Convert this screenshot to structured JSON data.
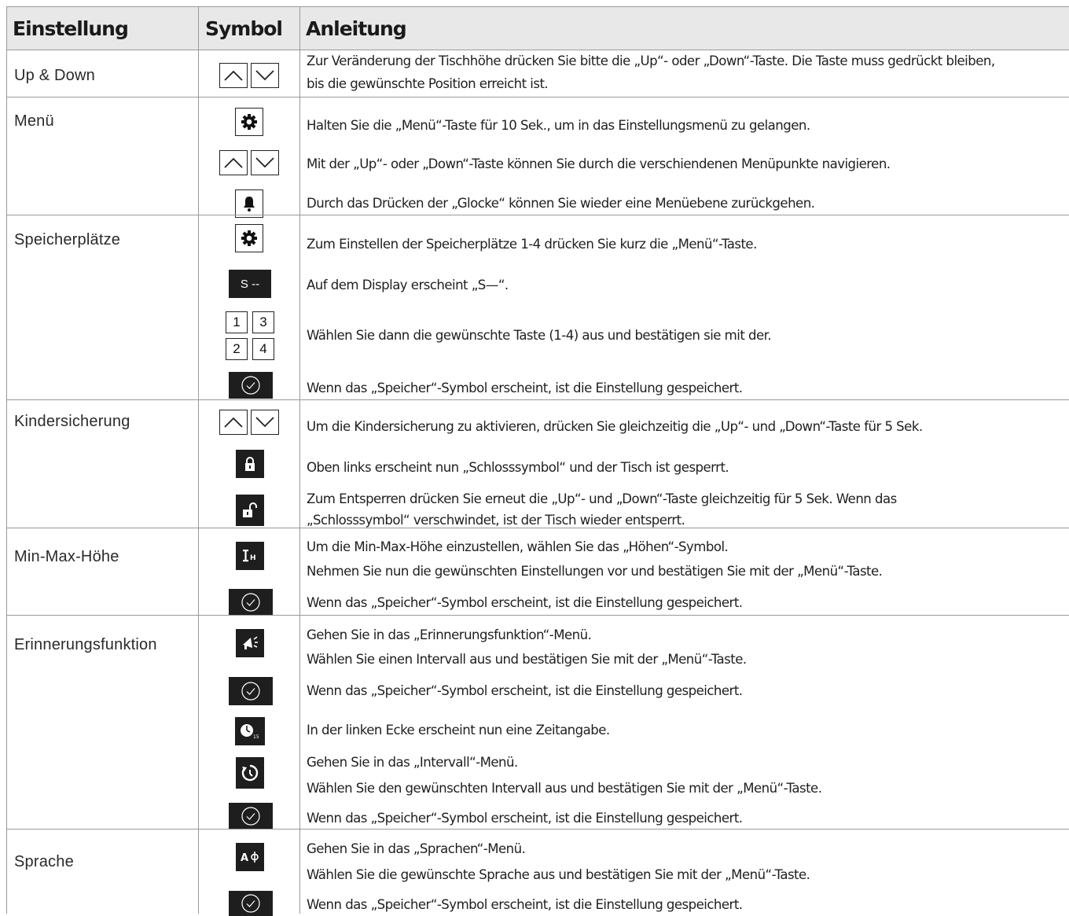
{
  "header": {
    "col1": "Einstellung",
    "col2": "Symbol",
    "col3": "Anleitung"
  },
  "rows": [
    {
      "name": "Up & Down",
      "lines": [
        "Zur Veränderung der Tischhöhe drücken Sie bitte die „Up“- oder „Down“-Taste. Die Taste muss gedrückt bleiben,",
        "bis die gewünschte Position erreicht ist."
      ]
    },
    {
      "name": "Menü",
      "lines": [
        "Halten Sie die „Menü“-Taste für 10 Sek., um in das Einstellungsmenü zu gelangen.",
        "Mit der „Up“- oder „Down“-Taste können Sie durch die verschiendenen Menüpunkte navigieren.",
        "Durch das Drücken der „Glocke“ können Sie wieder eine Menüebene zurückgehen."
      ]
    },
    {
      "name": "Speicherplätze",
      "display_text": "S --",
      "keys": [
        "1",
        "3",
        "2",
        "4"
      ],
      "lines": [
        "Zum Einstellen der Speicherplätze 1-4 drücken Sie kurz die „Menü“-Taste.",
        "Auf dem Display erscheint „S—“.",
        "Wählen Sie dann die gewünschte Taste (1-4) aus und bestätigen sie mit der.",
        "Wenn das „Speicher“-Symbol erscheint, ist die Einstellung gespeichert."
      ]
    },
    {
      "name": "Kindersicherung",
      "lines": [
        "Um die Kindersicherung zu aktivieren, drücken Sie gleichzeitig die „Up“- und „Down“-Taste für 5 Sek.",
        "Oben links erscheint nun „Schlosssymbol“ und der Tisch ist gesperrt.",
        "Zum Entsperren drücken Sie erneut die „Up“- und „Down“-Taste gleichzeitig für 5 Sek. Wenn das",
        "„Schlosssymbol“ verschwindet, ist der Tisch wieder entsperrt."
      ]
    },
    {
      "name": "Min-Max-Höhe",
      "lines": [
        "Um die Min-Max-Höhe einzustellen, wählen Sie das „Höhen“-Symbol.",
        "Nehmen Sie nun die gewünschten Einstellungen vor und bestätigen Sie mit der „Menü“-Taste.",
        "Wenn das „Speicher“-Symbol erscheint, ist die Einstellung gespeichert."
      ]
    },
    {
      "name": "Erinnerungsfunktion",
      "lines": [
        "Gehen Sie in das „Erinnerungsfunktion“-Menü.",
        "Wählen Sie einen Intervall aus und bestätigen Sie mit der „Menü“-Taste.",
        "Wenn das „Speicher“-Symbol erscheint, ist die Einstellung gespeichert.",
        "In der linken Ecke erscheint nun eine Zeitangabe.",
        "Gehen Sie in das „Intervall“-Menü.",
        "Wählen Sie den gewünschten Intervall aus und bestätigen Sie mit der „Menü“-Taste.",
        "Wenn das „Speicher“-Symbol erscheint, ist die Einstellung gespeichert."
      ]
    },
    {
      "name": "Sprache",
      "lines": [
        "Gehen Sie in das „Sprachen“-Menü.",
        "Wählen Sie die gewünschte Sprache aus und bestätigen Sie mit der „Menü“-Taste.",
        "Wenn das „Speicher“-Symbol erscheint, ist die Einstellung gespeichert."
      ]
    }
  ],
  "icons": {
    "height_label": "H",
    "timer_label": "15",
    "language_label": "A"
  },
  "colors": {
    "header_bg": "#e8e8e8",
    "rule": "#9a9a9a",
    "icon_dark": "#1e1e1e"
  }
}
